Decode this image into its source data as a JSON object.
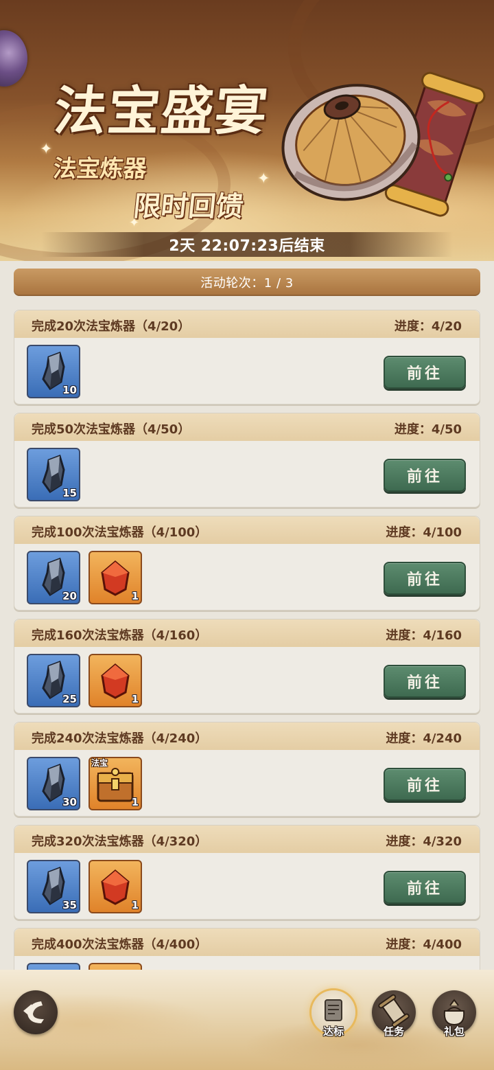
{
  "banner": {
    "title": "法宝盛宴",
    "subtitle1": "法宝炼器",
    "subtitle2": "限时回馈",
    "countdown": "2天 22:07:23后结束"
  },
  "round": {
    "text": "活动轮次：1 / 3"
  },
  "tasks": [
    {
      "name": "完成20次法宝炼器（4/20）",
      "progress": "进度：4/20",
      "button": "前往",
      "rewards": [
        {
          "icon": "iron-ore-icon",
          "qty": "10"
        }
      ]
    },
    {
      "name": "完成50次法宝炼器（4/50）",
      "progress": "进度：4/50",
      "button": "前往",
      "rewards": [
        {
          "icon": "iron-ore-icon",
          "qty": "15"
        }
      ]
    },
    {
      "name": "完成100次法宝炼器（4/100）",
      "progress": "进度：4/100",
      "button": "前往",
      "rewards": [
        {
          "icon": "iron-ore-icon",
          "qty": "20"
        },
        {
          "icon": "red-crystal-icon",
          "qty": "1"
        }
      ]
    },
    {
      "name": "完成160次法宝炼器（4/160）",
      "progress": "进度：4/160",
      "button": "前往",
      "rewards": [
        {
          "icon": "iron-ore-icon",
          "qty": "25"
        },
        {
          "icon": "red-crystal-icon",
          "qty": "1"
        }
      ]
    },
    {
      "name": "完成240次法宝炼器（4/240）",
      "progress": "进度：4/240",
      "button": "前往",
      "rewards": [
        {
          "icon": "iron-ore-icon",
          "qty": "30"
        },
        {
          "icon": "treasure-chest-icon",
          "qty": "1",
          "tag": "法宝"
        }
      ]
    },
    {
      "name": "完成320次法宝炼器（4/320）",
      "progress": "进度：4/320",
      "button": "前往",
      "rewards": [
        {
          "icon": "iron-ore-icon",
          "qty": "35"
        },
        {
          "icon": "red-crystal-icon",
          "qty": "1"
        }
      ]
    },
    {
      "name": "完成400次法宝炼器（4/400）",
      "progress": "进度：4/400",
      "button": "前往",
      "rewards": [
        {
          "icon": "iron-ore-icon",
          "qty": ""
        },
        {
          "icon": "red-crystal-icon",
          "qty": ""
        }
      ]
    }
  ],
  "nav": {
    "items": [
      {
        "label": "达标",
        "icon": "target-scroll-icon",
        "active": true
      },
      {
        "label": "任务",
        "icon": "scroll-icon",
        "active": false
      },
      {
        "label": "礼包",
        "icon": "gift-bag-icon",
        "active": false
      }
    ]
  },
  "colors": {
    "button_green": "#4a7a5c",
    "header_tan": "#e6d0a8",
    "round_bar": "#b07d47",
    "ore_bg": "#4a7cc4",
    "crystal_bg": "#ec9a3c"
  }
}
